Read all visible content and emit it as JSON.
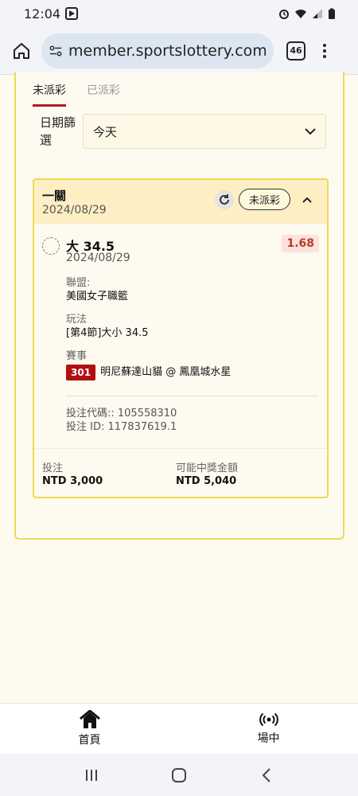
{
  "status_bar": {
    "time": "12:04"
  },
  "browser": {
    "url": "member.sportslottery.com.tw",
    "tab_count": "46"
  },
  "tabs": [
    {
      "label": "未派彩",
      "active": true
    },
    {
      "label": "已派彩",
      "active": false
    }
  ],
  "date_filter": {
    "label": "日期篩選",
    "value": "今天"
  },
  "bet": {
    "type": "一關",
    "date": "2024/08/29",
    "status": "未派彩",
    "selection": "大 34.5",
    "selection_date": "2024/08/29",
    "odds": "1.68",
    "league_label": "聯盟:",
    "league": "美國女子職籃",
    "play_label": "玩法",
    "play": "[第4節]大小 34.5",
    "event_label": "賽事",
    "event_no": "301",
    "event_name": "明尼蘇達山貓 @ 鳳凰城水星",
    "bet_code_text": "投注代碼:: 105558310",
    "bet_id_text": "投注 ID: 117837619.1",
    "stake_label": "投注",
    "stake": "NTD 3,000",
    "win_label": "可能中獎金額",
    "win": "NTD 5,040"
  },
  "bottom_nav": [
    {
      "label": "首頁",
      "icon": "home-icon"
    },
    {
      "label": "場中",
      "icon": "live-broadcast-icon"
    }
  ],
  "colors": {
    "accent_red": "#b01c1c",
    "card_border": "#f0d957",
    "card_header": "#fdeec4"
  }
}
